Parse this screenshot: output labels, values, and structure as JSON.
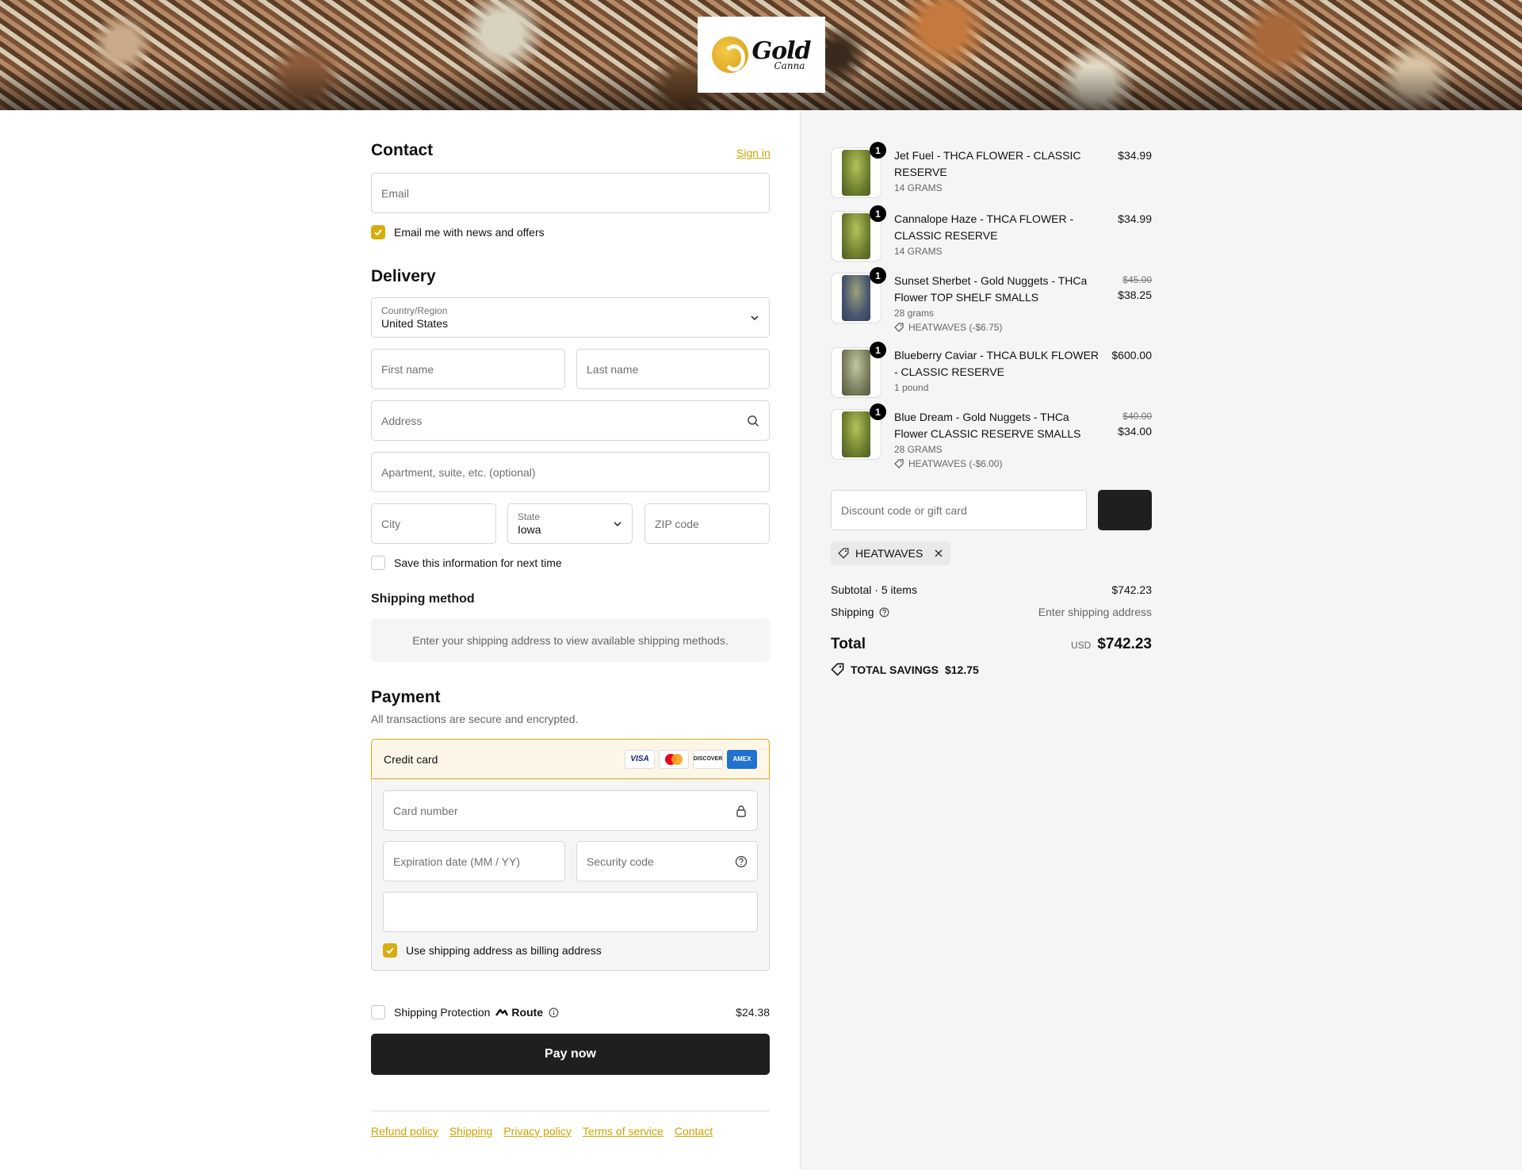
{
  "brand": {
    "logo_main": "Gold",
    "logo_sub": "Canna"
  },
  "contact": {
    "heading": "Contact",
    "sign_in": "Sign in",
    "email_placeholder": "Email",
    "news_label": "Email me with news and offers"
  },
  "delivery": {
    "heading": "Delivery",
    "country_label": "Country/Region",
    "country_value": "United States",
    "first_name_placeholder": "First name",
    "last_name_placeholder": "Last name",
    "address_placeholder": "Address",
    "apartment_placeholder": "Apartment, suite, etc. (optional)",
    "city_placeholder": "City",
    "state_label": "State",
    "state_value": "Iowa",
    "zip_placeholder": "ZIP code",
    "save_label": "Save this information for next time"
  },
  "shipping_method": {
    "heading": "Shipping method",
    "notice": "Enter your shipping address to view available shipping methods."
  },
  "payment": {
    "heading": "Payment",
    "subtitle": "All transactions are secure and encrypted.",
    "method": "Credit card",
    "cards": [
      "VISA",
      "MC",
      "DISCOVER",
      "AMEX"
    ],
    "card_number_placeholder": "Card number",
    "expiry_placeholder": "Expiration date (MM / YY)",
    "security_placeholder": "Security code",
    "billing_label": "Use shipping address as billing address"
  },
  "protection": {
    "label": "Shipping Protection",
    "brand": "Route",
    "price": "$24.38"
  },
  "pay_button": "Pay now",
  "footer_links": [
    "Refund policy",
    "Shipping",
    "Privacy policy",
    "Terms of service",
    "Contact"
  ],
  "cart": {
    "items": [
      {
        "qty": "1",
        "title": "Jet Fuel - THCA FLOWER - CLASSIC RESERVE",
        "variant": "14 GRAMS",
        "price": "$34.99"
      },
      {
        "qty": "1",
        "title": "Cannalope Haze - THCA FLOWER - CLASSIC RESERVE",
        "variant": "14 GRAMS",
        "price": "$34.99"
      },
      {
        "qty": "1",
        "title": "Sunset Sherbet - Gold Nuggets - THCa Flower TOP SHELF SMALLS",
        "variant": "28 grams",
        "discount": "HEATWAVES (-$6.75)",
        "old_price": "$45.00",
        "price": "$38.25"
      },
      {
        "qty": "1",
        "title": "Blueberry Caviar - THCA BULK FLOWER - CLASSIC RESERVE",
        "variant": "1 pound",
        "price": "$600.00"
      },
      {
        "qty": "1",
        "title": "Blue Dream - Gold Nuggets - THCa Flower CLASSIC RESERVE SMALLS",
        "variant": "28 GRAMS",
        "discount": "HEATWAVES (-$6.00)",
        "old_price": "$40.00",
        "price": "$34.00"
      }
    ],
    "discount_placeholder": "Discount code or gift card",
    "applied_code": "HEATWAVES",
    "subtotal_label": "Subtotal · 5 items",
    "subtotal_value": "$742.23",
    "shipping_label": "Shipping",
    "shipping_value": "Enter shipping address",
    "total_label": "Total",
    "currency": "USD",
    "total_value": "$742.23",
    "savings_label": "TOTAL SAVINGS",
    "savings_value": "$12.75"
  },
  "colors": {
    "accent": "#d7ac0e",
    "dark": "#1f1f1f",
    "panel": "#f5f5f5"
  }
}
